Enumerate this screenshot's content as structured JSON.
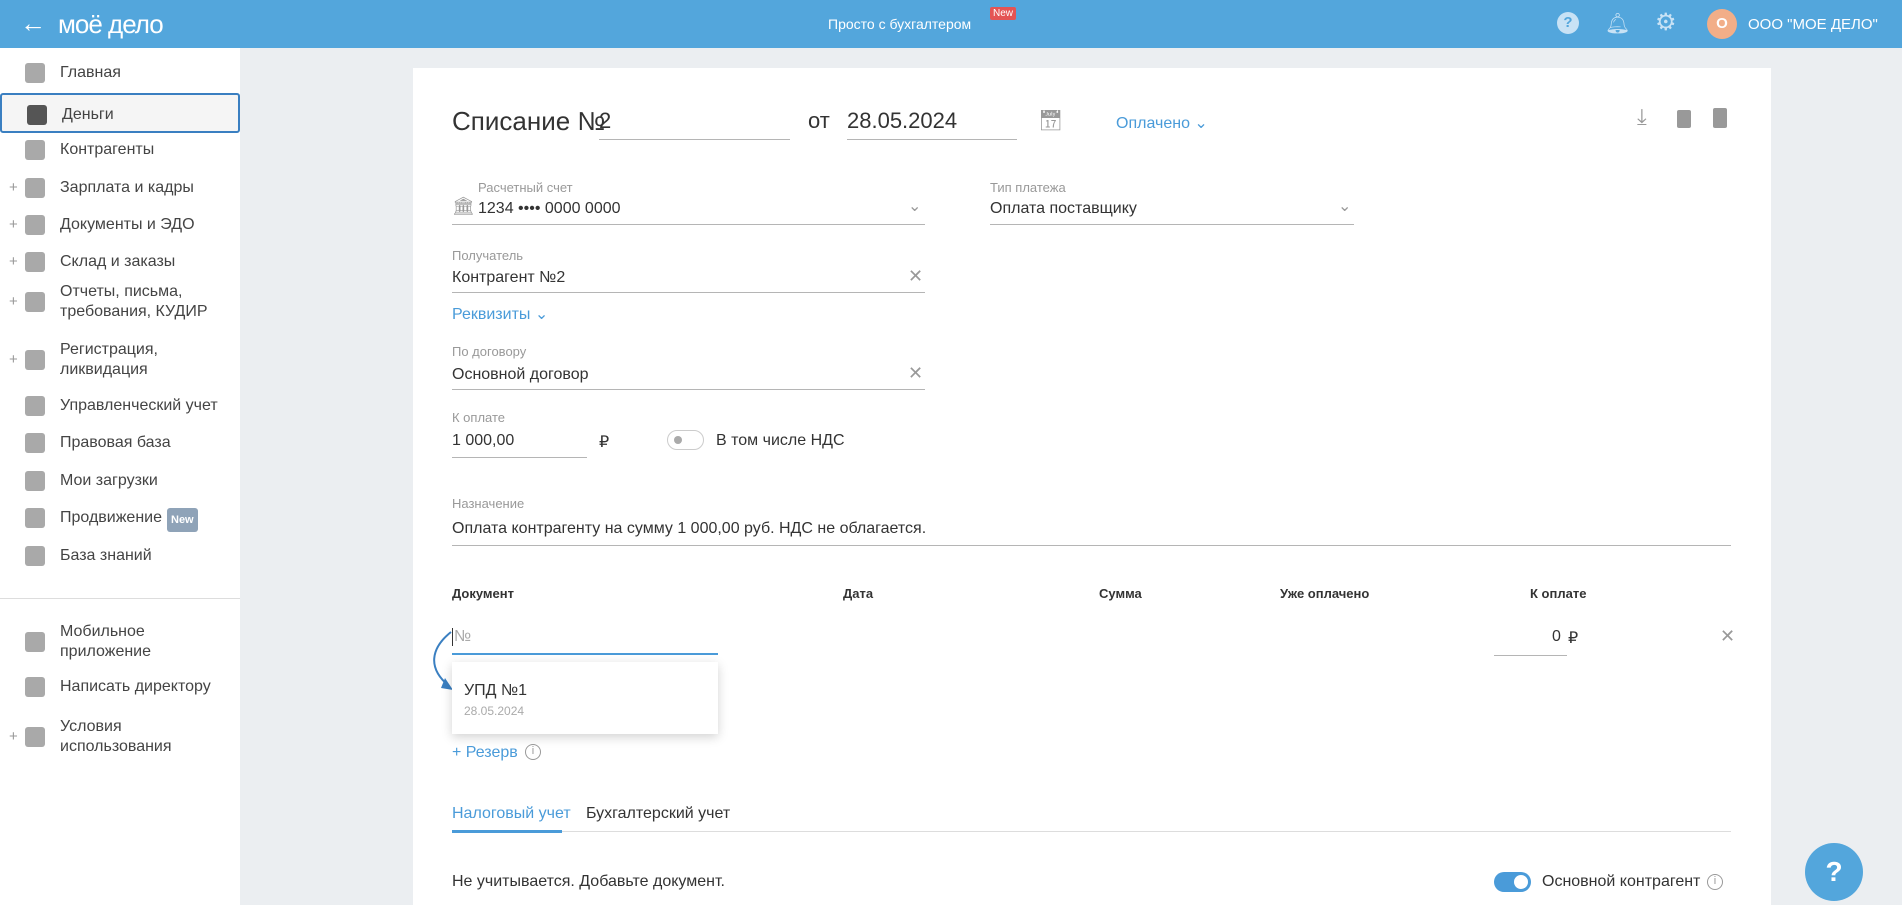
{
  "header": {
    "logo": "моё дело",
    "center": "Просто с бухгалтером",
    "center_badge": "New",
    "avatar": "О",
    "company": "ООО \"МОЕ ДЕЛО\""
  },
  "sidebar": {
    "items": [
      {
        "label": "Главная",
        "plus": false
      },
      {
        "label": "Деньги",
        "plus": false,
        "active": true
      },
      {
        "label": "Контрагенты",
        "plus": false
      },
      {
        "label": "Зарплата и кадры",
        "plus": true
      },
      {
        "label": "Документы и ЭДО",
        "plus": true
      },
      {
        "label": "Склад и заказы",
        "plus": true
      },
      {
        "label": "Отчеты, письма,\nтребования, КУДИР",
        "plus": true
      },
      {
        "label": "Регистрация,\nликвидация",
        "plus": true
      },
      {
        "label": "Управленческий учет",
        "plus": false
      },
      {
        "label": "Правовая база",
        "plus": false
      },
      {
        "label": "Мои загрузки",
        "plus": false
      },
      {
        "label": "Продвижение",
        "plus": false,
        "badge": "New"
      },
      {
        "label": "База знаний",
        "plus": false
      }
    ],
    "bottom": [
      {
        "label": "Мобильное\nприложение"
      },
      {
        "label": "Написать директору"
      },
      {
        "label": "Условия\nиспользования"
      }
    ]
  },
  "form": {
    "title": "Списание №",
    "number": "2",
    "from": "от",
    "date": "28.05.2024",
    "status": "Оплачено",
    "account_label": "Расчетный счет",
    "account_value": "1234 •••• 0000 0000",
    "paytype_label": "Тип платежа",
    "paytype_value": "Оплата поставщику",
    "recipient_label": "Получатель",
    "recipient_value": "Контрагент №2",
    "details_link": "Реквизиты",
    "contract_label": "По договору",
    "contract_value": "Основной договор",
    "amount_label": "К оплате",
    "amount_value": "1 000,00",
    "currency": "₽",
    "vat_label": "В том числе НДС",
    "purpose_label": "Назначение",
    "purpose_value": "Оплата контрагенту на сумму 1 000,00 руб. НДС не облагается.",
    "table": {
      "headers": [
        "Документ",
        "Дата",
        "Сумма",
        "Уже оплачено",
        "К оплате"
      ],
      "doc_placeholder": "№",
      "to_pay": "0",
      "currency": "₽"
    },
    "suggestion": {
      "title": "УПД №1",
      "date": "28.05.2024"
    },
    "reserve_link": "+ Резерв",
    "tabs": [
      "Налоговый учет",
      "Бухгалтерский учет"
    ],
    "tax_note": "Не учитывается. Добавьте документ.",
    "main_counterparty_label": "Основной контрагент"
  },
  "colors": {
    "header": "#53a6dc",
    "accent": "#4a9bd9",
    "avatar": "#f2ae88"
  }
}
